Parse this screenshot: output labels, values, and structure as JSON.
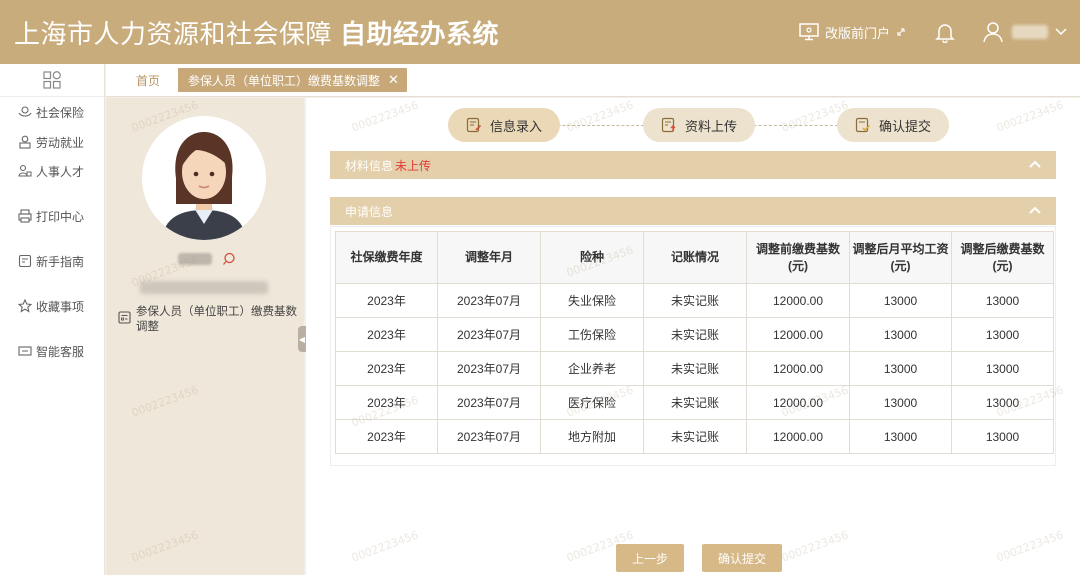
{
  "header": {
    "title_light": "上海市人力资源和社会保障",
    "title_bold": "自助经办系统",
    "portal_label": "改版前门户"
  },
  "sidebar": {
    "items": [
      {
        "label": "社会保险",
        "icon": "social-insurance-icon"
      },
      {
        "label": "劳动就业",
        "icon": "employment-icon"
      },
      {
        "label": "人事人才",
        "icon": "talent-icon"
      },
      {
        "label": "打印中心",
        "icon": "printer-icon"
      },
      {
        "label": "新手指南",
        "icon": "guide-icon"
      },
      {
        "label": "收藏事项",
        "icon": "star-icon"
      },
      {
        "label": "智能客服",
        "icon": "chat-icon"
      }
    ]
  },
  "breadcrumb": {
    "home": "首页",
    "current_tab": "参保人员（单位职工）缴费基数调整"
  },
  "profile": {
    "item_label": "参保人员（单位职工）缴费基数调整"
  },
  "steps": [
    {
      "label": "信息录入",
      "active": true
    },
    {
      "label": "资料上传",
      "active": false
    },
    {
      "label": "确认提交",
      "active": false
    }
  ],
  "material_section": {
    "title": "材料信息",
    "status": "未上传"
  },
  "apply_section": {
    "title": "申请信息"
  },
  "table": {
    "headers": [
      "社保缴费年度",
      "调整年月",
      "险种",
      "记账情况",
      "调整前缴费基数(元)",
      "调整后月平均工资(元)",
      "调整后缴费基数(元)"
    ],
    "rows": [
      [
        "2023年",
        "2023年07月",
        "失业保险",
        "未实记账",
        "12000.00",
        "13000",
        "13000"
      ],
      [
        "2023年",
        "2023年07月",
        "工伤保险",
        "未实记账",
        "12000.00",
        "13000",
        "13000"
      ],
      [
        "2023年",
        "2023年07月",
        "企业养老",
        "未实记账",
        "12000.00",
        "13000",
        "13000"
      ],
      [
        "2023年",
        "2023年07月",
        "医疗保险",
        "未实记账",
        "12000.00",
        "13000",
        "13000"
      ],
      [
        "2023年",
        "2023年07月",
        "地方附加",
        "未实记账",
        "12000.00",
        "13000",
        "13000"
      ]
    ]
  },
  "buttons": {
    "prev": "上一步",
    "confirm": "确认提交"
  },
  "watermark": "0002223456",
  "colors": {
    "brand": "#c9ac7c",
    "section": "#e3cfaa",
    "button": "#d7b887",
    "warning": "#e53935"
  }
}
